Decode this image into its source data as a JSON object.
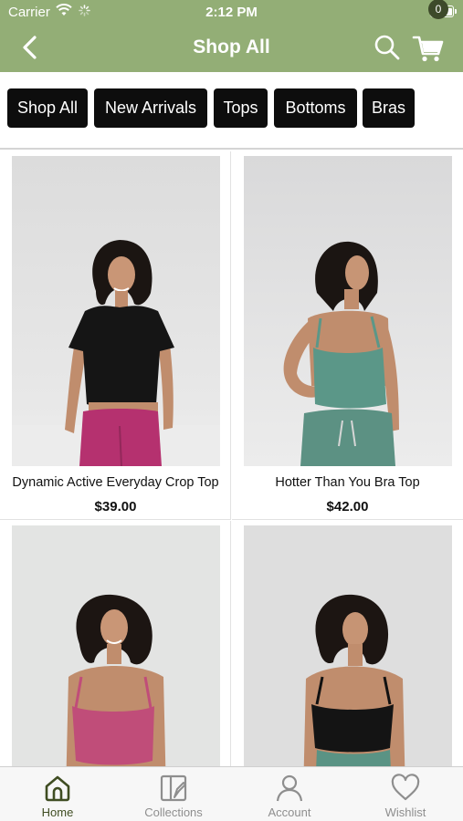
{
  "status_bar": {
    "carrier": "Carrier",
    "time": "2:12 PM"
  },
  "header": {
    "title": "Shop All",
    "cart_count": "0"
  },
  "categories": [
    "Shop All",
    "New Arrivals",
    "Tops",
    "Bottoms",
    "Bras"
  ],
  "products": [
    {
      "name": "Dynamic Active Everyday Crop Top",
      "price": "$39.00"
    },
    {
      "name": "Hotter Than You Bra Top",
      "price": "$42.00"
    },
    {
      "name": "",
      "price": ""
    },
    {
      "name": "",
      "price": ""
    }
  ],
  "tabs": [
    {
      "label": "Home",
      "icon": "home-icon",
      "active": true
    },
    {
      "label": "Collections",
      "icon": "collections-icon",
      "active": false
    },
    {
      "label": "Account",
      "icon": "account-icon",
      "active": false
    },
    {
      "label": "Wishlist",
      "icon": "heart-icon",
      "active": false
    }
  ],
  "colors": {
    "header_bg": "#93ae76",
    "chip_bg": "#0d0d0d",
    "active_tab": "#3f4d22",
    "inactive_tab": "#8e8e8e",
    "cart_badge": "#3d4a2a"
  }
}
